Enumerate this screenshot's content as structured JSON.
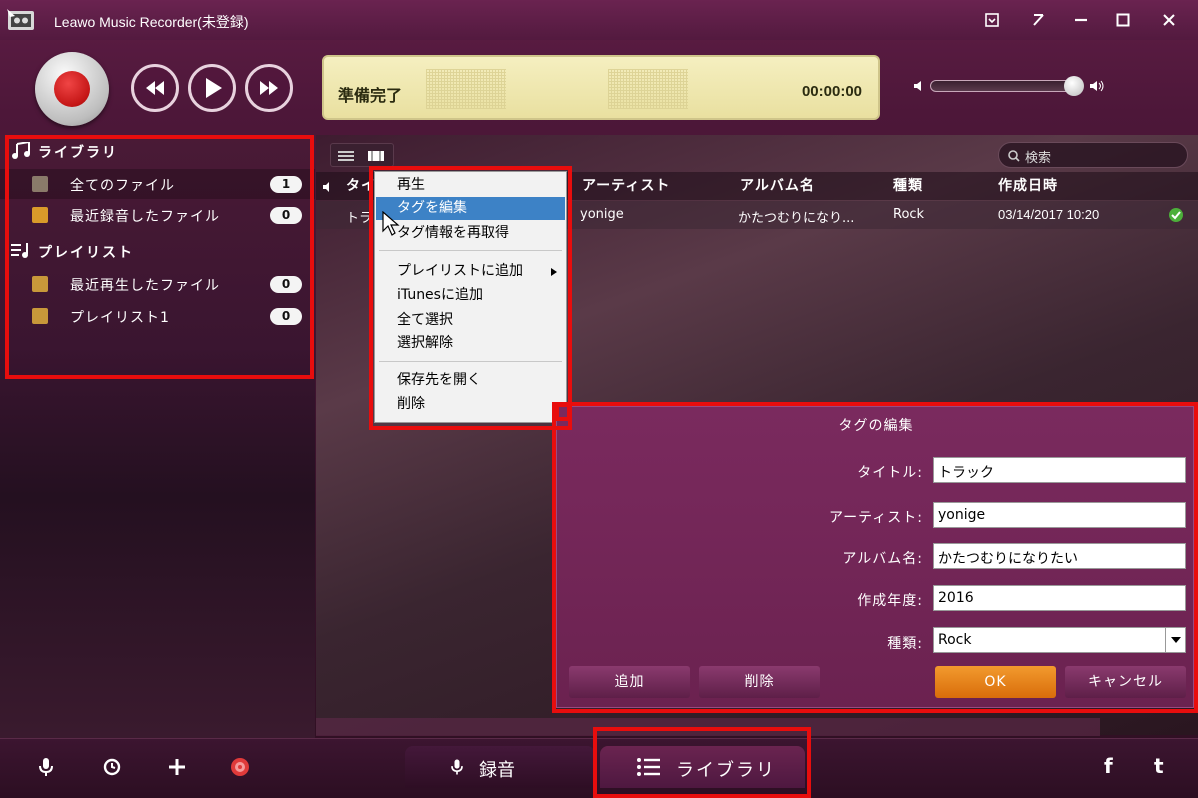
{
  "window": {
    "title": "Leawo Music Recorder(未登録)"
  },
  "player": {
    "status": "準備完了",
    "time": "00:00:00"
  },
  "sidebar": {
    "library_header": "ライブラリ",
    "playlist_header": "プレイリスト",
    "library_items": [
      {
        "label": "全てのファイル",
        "count": "1"
      },
      {
        "label": "最近録音したファイル",
        "count": "0"
      }
    ],
    "playlist_items": [
      {
        "label": "最近再生したファイル",
        "count": "0"
      },
      {
        "label": "プレイリスト1",
        "count": "0"
      }
    ]
  },
  "search": {
    "placeholder": "検索"
  },
  "table": {
    "headers": [
      "タイトル",
      "アーティスト",
      "アルバム名",
      "種類",
      "作成日時"
    ],
    "row": {
      "title": "トラ",
      "artist": "yonige",
      "album": "かたつむりになり...",
      "genre": "Rock",
      "date": "03/14/2017 10:20"
    }
  },
  "context_menu": {
    "items": [
      "再生",
      "タグを編集",
      "タグ情報を再取得",
      "プレイリストに追加",
      "iTunesに追加",
      "全て選択",
      "選択解除",
      "保存先を開く",
      "削除"
    ]
  },
  "tag_dialog": {
    "title": "タグの編集",
    "fields": [
      {
        "label": "タイトル:",
        "value": "トラック"
      },
      {
        "label": "アーティスト:",
        "value": "yonige"
      },
      {
        "label": "アルバム名:",
        "value": "かたつむりになりたい"
      },
      {
        "label": "作成年度:",
        "value": "2016"
      },
      {
        "label": "種類:",
        "value": "Rock"
      }
    ],
    "buttons": {
      "add": "追加",
      "delete": "削除",
      "ok": "OK",
      "cancel": "キャンセル"
    }
  },
  "bottom_tabs": {
    "record": "録音",
    "library": "ライブラリ"
  },
  "social": {
    "facebook": "f",
    "tumblr": "t"
  },
  "colors": {
    "accent": "#e80d0d",
    "ok_button": "#e8841a",
    "menu_highlight": "#3d82c6"
  }
}
